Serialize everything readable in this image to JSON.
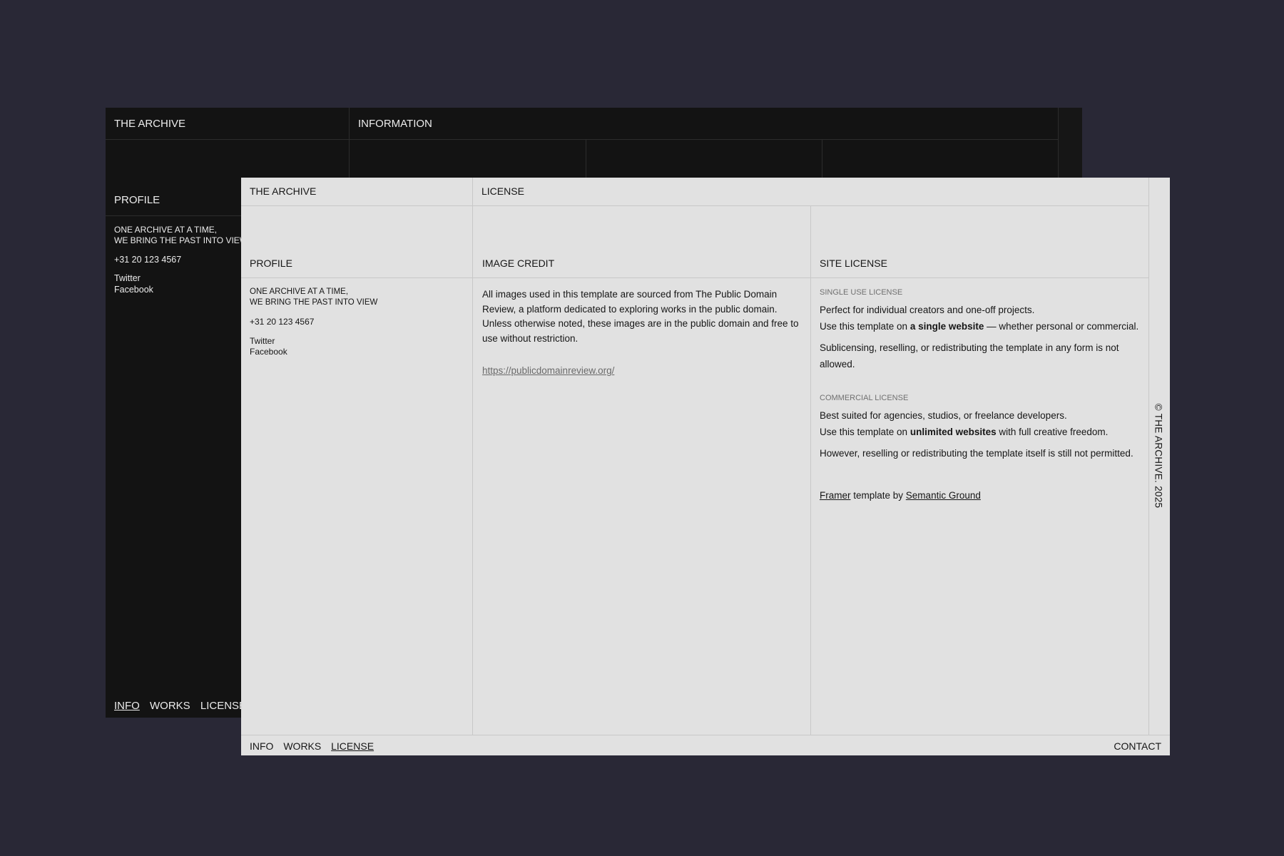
{
  "colors": {
    "background": "#292836",
    "dark_window": "#131313",
    "light_window": "#e1e1e1",
    "text_dark": "#161616",
    "text_light": "#ececec",
    "muted": "#707070"
  },
  "back_window": {
    "brand": "THE ARCHIVE",
    "section": "INFORMATION",
    "profile_heading": "PROFILE",
    "tagline_line1": "ONE ARCHIVE AT A TIME,",
    "tagline_line2": "WE BRING THE PAST INTO VIEW",
    "phone": "+31 20 123 4567",
    "social": [
      "Twitter",
      "Facebook"
    ],
    "nav": [
      "INFO",
      "WORKS",
      "LICENSE"
    ],
    "nav_active": "INFO"
  },
  "front_window": {
    "brand": "THE ARCHIVE",
    "section": "LICENSE",
    "profile_heading": "PROFILE",
    "image_credit_heading": "IMAGE CREDIT",
    "site_license_heading": "SITE LICENSE",
    "tagline_line1": "ONE ARCHIVE AT A TIME,",
    "tagline_line2": "WE BRING THE PAST INTO VIEW",
    "phone": "+31 20 123 4567",
    "social": [
      "Twitter",
      "Facebook"
    ],
    "image_credit_text": "All images used in this template are sourced from The Public Domain Review, a platform dedicated to exploring works in the public domain. Unless otherwise noted, these images are in the public domain and free to use without restriction.",
    "image_credit_link": "https://publicdomainreview.org/",
    "single_license": {
      "title": "SINGLE USE LICENSE",
      "line1": "Perfect for individual creators and one-off projects.",
      "line2_pre": "Use this template on ",
      "line2_bold": "a single website",
      "line2_post": " — whether personal or commercial.",
      "line3": "Sublicensing, reselling, or redistributing the template in any form is not allowed."
    },
    "commercial_license": {
      "title": "COMMERCIAL LICENSE",
      "line1": "Best suited for agencies, studios, or freelance developers.",
      "line2_pre": "Use this template on ",
      "line2_bold": "unlimited websites",
      "line2_post": " with full creative freedom.",
      "line3": "However, reselling or redistributing the template itself is still not permitted."
    },
    "credit_framer": "Framer",
    "credit_mid": " template by ",
    "credit_author": "Semantic Ground",
    "vertical_text": "© THE ARCHIVE. 2025",
    "nav": [
      "INFO",
      "WORKS",
      "LICENSE"
    ],
    "nav_active": "LICENSE",
    "contact": "CONTACT"
  }
}
